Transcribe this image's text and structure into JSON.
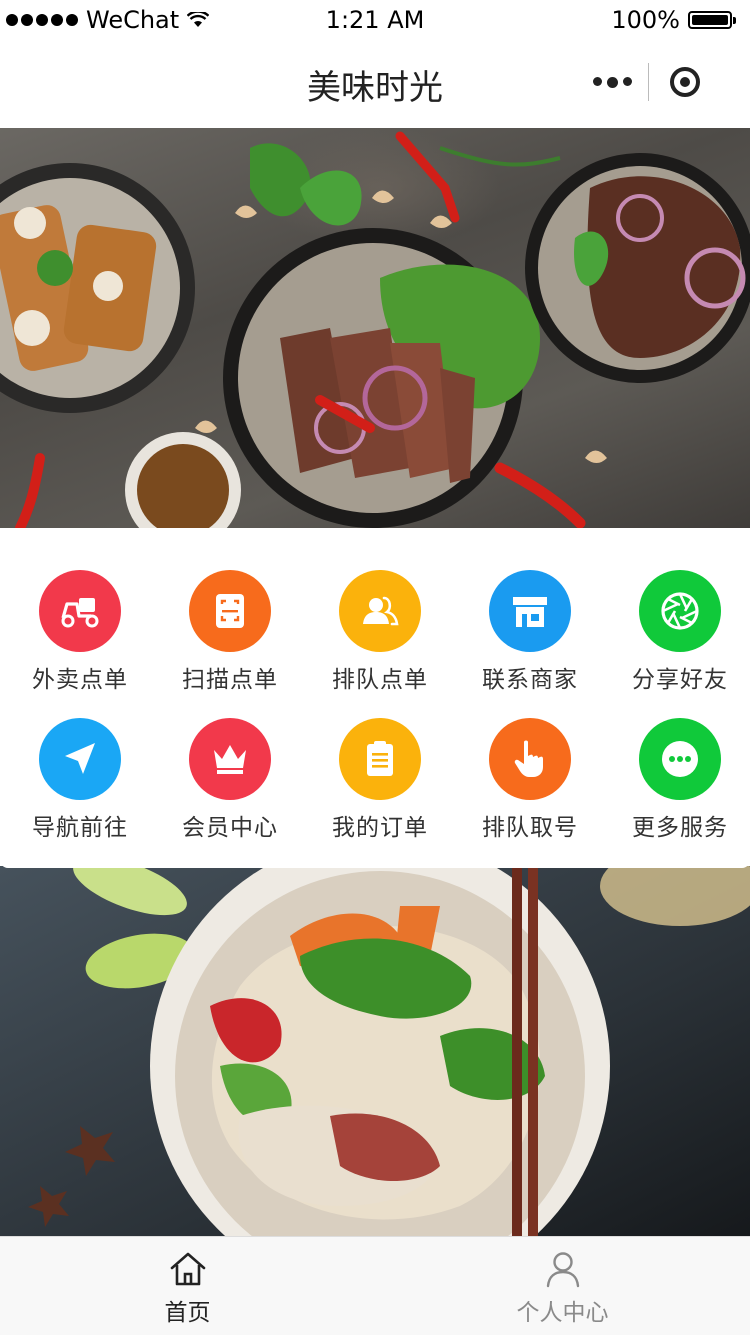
{
  "status_bar": {
    "carrier": "WeChat",
    "time": "1:21 AM",
    "battery": "100%",
    "battery_level": 1.0
  },
  "nav": {
    "title": "美味时光"
  },
  "menu": {
    "items": [
      {
        "label": "外卖点单",
        "icon": "scooter-icon",
        "color": "#f2394b"
      },
      {
        "label": "扫描点单",
        "icon": "scan-icon",
        "color": "#f76b1c"
      },
      {
        "label": "排队点单",
        "icon": "users-icon",
        "color": "#fbb20c"
      },
      {
        "label": "联系商家",
        "icon": "store-icon",
        "color": "#1a9bf0"
      },
      {
        "label": "分享好友",
        "icon": "aperture-icon",
        "color": "#10c93a"
      },
      {
        "label": "导航前往",
        "icon": "navigation-icon",
        "color": "#1aa7f5"
      },
      {
        "label": "会员中心",
        "icon": "crown-icon",
        "color": "#f2394b"
      },
      {
        "label": "我的订单",
        "icon": "clipboard-icon",
        "color": "#fbb20c"
      },
      {
        "label": "排队取号",
        "icon": "hand-pointer-icon",
        "color": "#f76b1c"
      },
      {
        "label": "更多服务",
        "icon": "more-chat-icon",
        "color": "#10c93a"
      }
    ]
  },
  "tabs": [
    {
      "label": "首页",
      "icon": "home-icon",
      "active": true
    },
    {
      "label": "个人中心",
      "icon": "user-icon",
      "active": false
    }
  ],
  "colors": {
    "tab_active": "#222222",
    "tab_inactive": "#8a8a8a"
  }
}
